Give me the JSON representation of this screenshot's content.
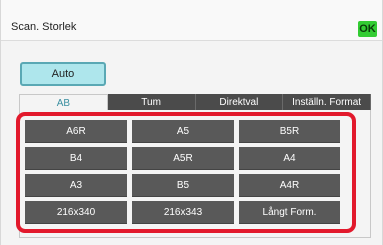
{
  "title": "Scan. Storlek",
  "ok_label": "OK",
  "auto_label": "Auto",
  "tabs": [
    {
      "label": "AB",
      "active": true
    },
    {
      "label": "Tum",
      "active": false
    },
    {
      "label": "Direktval",
      "active": false
    },
    {
      "label": "Inställn. Format",
      "active": false
    }
  ],
  "sizes": [
    [
      "A6R",
      "A5",
      "B5R"
    ],
    [
      "B4",
      "A5R",
      "A4"
    ],
    [
      "A3",
      "B5",
      "A4R"
    ],
    [
      "216x340",
      "216x343",
      "Långt Form."
    ]
  ],
  "colors": {
    "ok": "#33cc33",
    "auto_bg": "#aee6ec",
    "active_tab_text": "#3a8fa0",
    "button_bg": "#595959",
    "highlight": "#e2192c"
  }
}
